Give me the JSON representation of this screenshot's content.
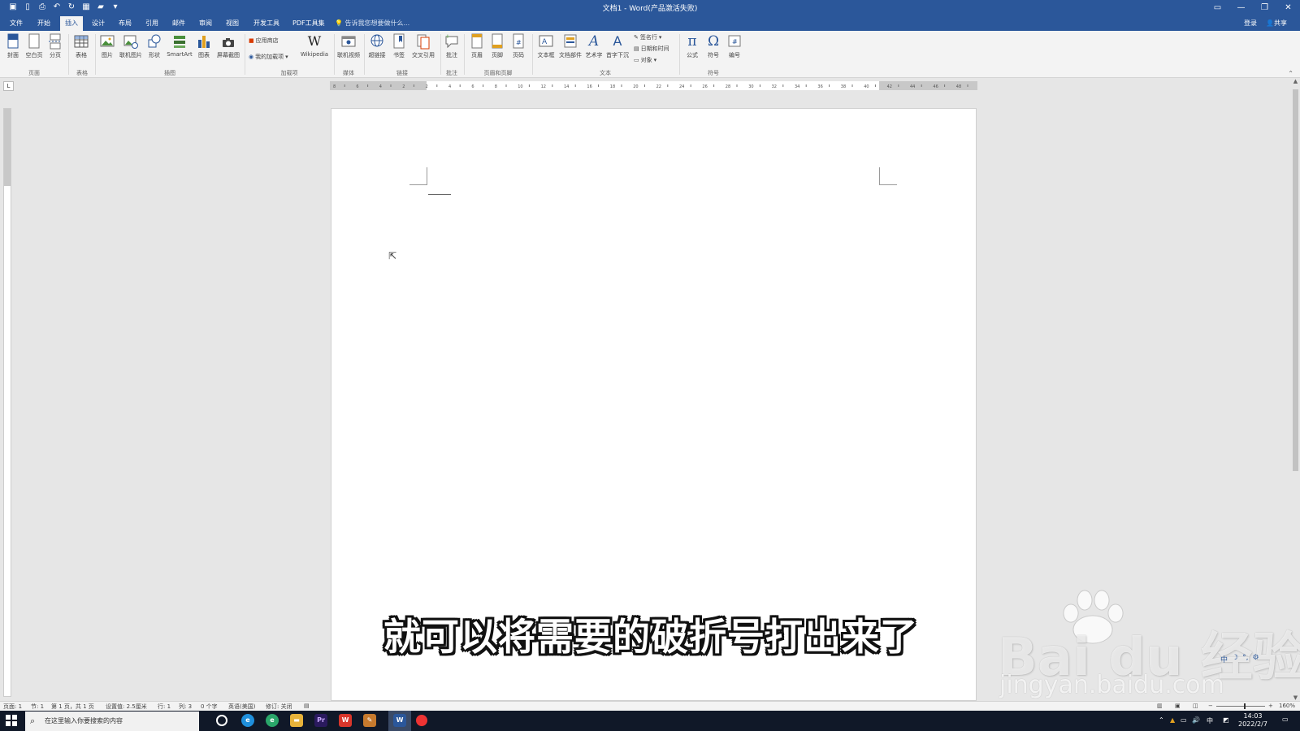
{
  "titlebar": {
    "title": "文档1 - Word(产品激活失败)",
    "qat_icons": [
      "save-icon",
      "new-doc-icon",
      "print-preview-icon",
      "undo-icon",
      "redo-icon",
      "table-icon",
      "open-icon",
      "customize-icon"
    ],
    "window_controls": [
      "ribbon-display-icon",
      "minimize-icon",
      "restore-icon",
      "close-icon"
    ]
  },
  "tabs": {
    "file": "文件",
    "home": "开始",
    "insert": "插入",
    "design": "设计",
    "layout": "布局",
    "references": "引用",
    "mailings": "邮件",
    "review": "审阅",
    "view": "视图",
    "developer": "开发工具",
    "pdf": "PDF工具集",
    "tell_me": "告诉我您想要做什么...",
    "signin": "登录",
    "share": "共享"
  },
  "ribbon": {
    "pages": {
      "cover": "封面",
      "blank": "空白页",
      "break": "分页",
      "group": "页面"
    },
    "tables": {
      "table": "表格",
      "group": "表格"
    },
    "illustrations": {
      "picture": "图片",
      "online_picture": "联机图片",
      "shapes": "形状",
      "smartart": "SmartArt",
      "chart": "图表",
      "screenshot": "屏幕截图",
      "group": "插图"
    },
    "addins": {
      "store": "应用商店",
      "my_addins": "我的加载项",
      "wikipedia": "Wikipedia",
      "group": "加载项"
    },
    "media": {
      "online_video": "联机视频",
      "group": "媒体"
    },
    "links": {
      "hyperlink": "超链接",
      "bookmark": "书签",
      "cross_ref": "交叉引用",
      "group": "链接"
    },
    "comments": {
      "comment": "批注",
      "group": "批注"
    },
    "header_footer": {
      "header": "页眉",
      "footer": "页脚",
      "page_number": "页码",
      "group": "页眉和页脚"
    },
    "text": {
      "textbox": "文本框",
      "quick_parts": "文档部件",
      "wordart": "艺术字",
      "dropcap": "首字下沉",
      "signature": "签名行",
      "datetime": "日期和时间",
      "object": "对象",
      "group": "文本"
    },
    "symbols": {
      "equation": "公式",
      "symbol": "符号",
      "number": "编号",
      "group": "符号"
    }
  },
  "ruler_numbers": [
    "8",
    "6",
    "4",
    "2",
    "2",
    "4",
    "6",
    "8",
    "10",
    "12",
    "14",
    "16",
    "18",
    "20",
    "22",
    "24",
    "26",
    "28",
    "30",
    "32",
    "34",
    "36",
    "38",
    "40",
    "42",
    "44",
    "46",
    "48"
  ],
  "ruler_corner": "L",
  "subtitle": "就可以将需要的破折号打出来了",
  "watermark": {
    "brand": "Bai du 经验",
    "url": "jingyan.baidu.com"
  },
  "ime": [
    "中",
    "☽",
    "°,",
    "⚙"
  ],
  "status": {
    "page": "页面: 1",
    "section": "节: 1",
    "page_of": "第 1 页，共 1 页",
    "position": "设置值: 2.5厘米",
    "line": "行: 1",
    "column": "列: 3",
    "words": "0 个字",
    "language": "英语(美国)",
    "track": "修订: 关闭",
    "zoom": "160%"
  },
  "taskbar": {
    "search_placeholder": "在这里输入你要搜索的内容",
    "apps": [
      "cortana-icon",
      "edge-icon",
      "edge-dev-icon",
      "file-explorer-icon",
      "premiere-icon",
      "wps-icon",
      "feather-icon",
      "word-icon",
      "record-icon"
    ],
    "ime_indicator": "中",
    "time": "14:03",
    "date": "2022/2/7"
  }
}
